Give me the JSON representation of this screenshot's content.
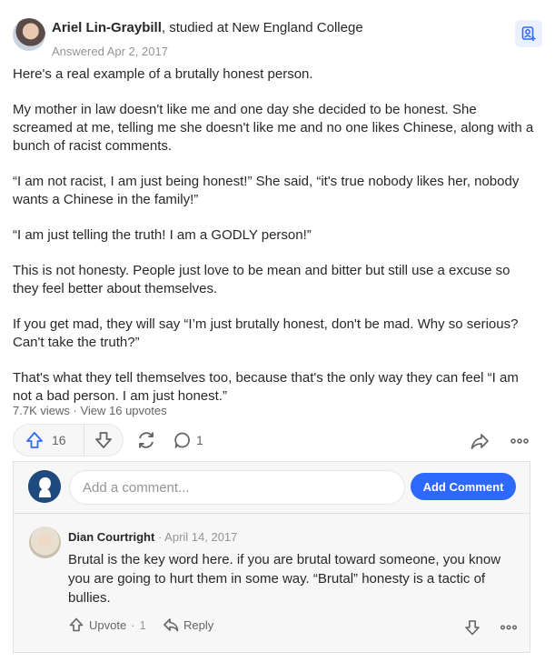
{
  "answer": {
    "author_name": "Ariel Lin-Graybill",
    "author_credential": ", studied at New England College",
    "answered_date": "Answered Apr 2, 2017",
    "paragraphs": [
      "Here's a real example of a brutally honest person.",
      "My mother in law doesn't like me and one day she decided to be honest. She screamed at me, telling me she doesn't like me and no one likes Chinese, along with a bunch of racist comments.",
      "“I am not racist, I am just being honest!” She said, “it's true nobody likes her, nobody wants a Chinese in the family!”",
      "“I am just telling the truth! I am a GODLY person!”",
      "This is not honesty. People just love to be mean and bitter but still use a excuse so they feel better about themselves.",
      "If you get mad, they will say “I’m just brutally honest, don't be mad. Why so serious? Can't take the truth?”",
      "That's what they tell themselves too, because that's the only way they can feel “I am not a bad person. I am just honest.”"
    ],
    "views": "7.7K views",
    "stat_sep": " · ",
    "upvotes_link": "View 16 upvotes"
  },
  "actions": {
    "upvote_count": "16",
    "comment_count": "1"
  },
  "comments": {
    "placeholder": "Add a comment...",
    "add_button": "Add Comment",
    "items": [
      {
        "author": "Dian Courtright",
        "sep": " · ",
        "date": "April 14, 2017",
        "text": "Brutal is the key word here. if you are brutal toward someone, you know you are going to hurt them in some way. “Brutal” honesty is a tactic of bullies.",
        "upvote_label": "Upvote",
        "upvote_sep": "·",
        "upvote_count": "1",
        "reply_label": "Reply"
      }
    ]
  },
  "colors": {
    "accent": "#2e69ff",
    "text": "#282829",
    "muted": "#939598"
  },
  "icons": [
    "follow-icon",
    "upvote-icon",
    "downvote-icon",
    "reshare-icon",
    "comment-icon",
    "share-icon",
    "more-icon",
    "reply-icon"
  ]
}
